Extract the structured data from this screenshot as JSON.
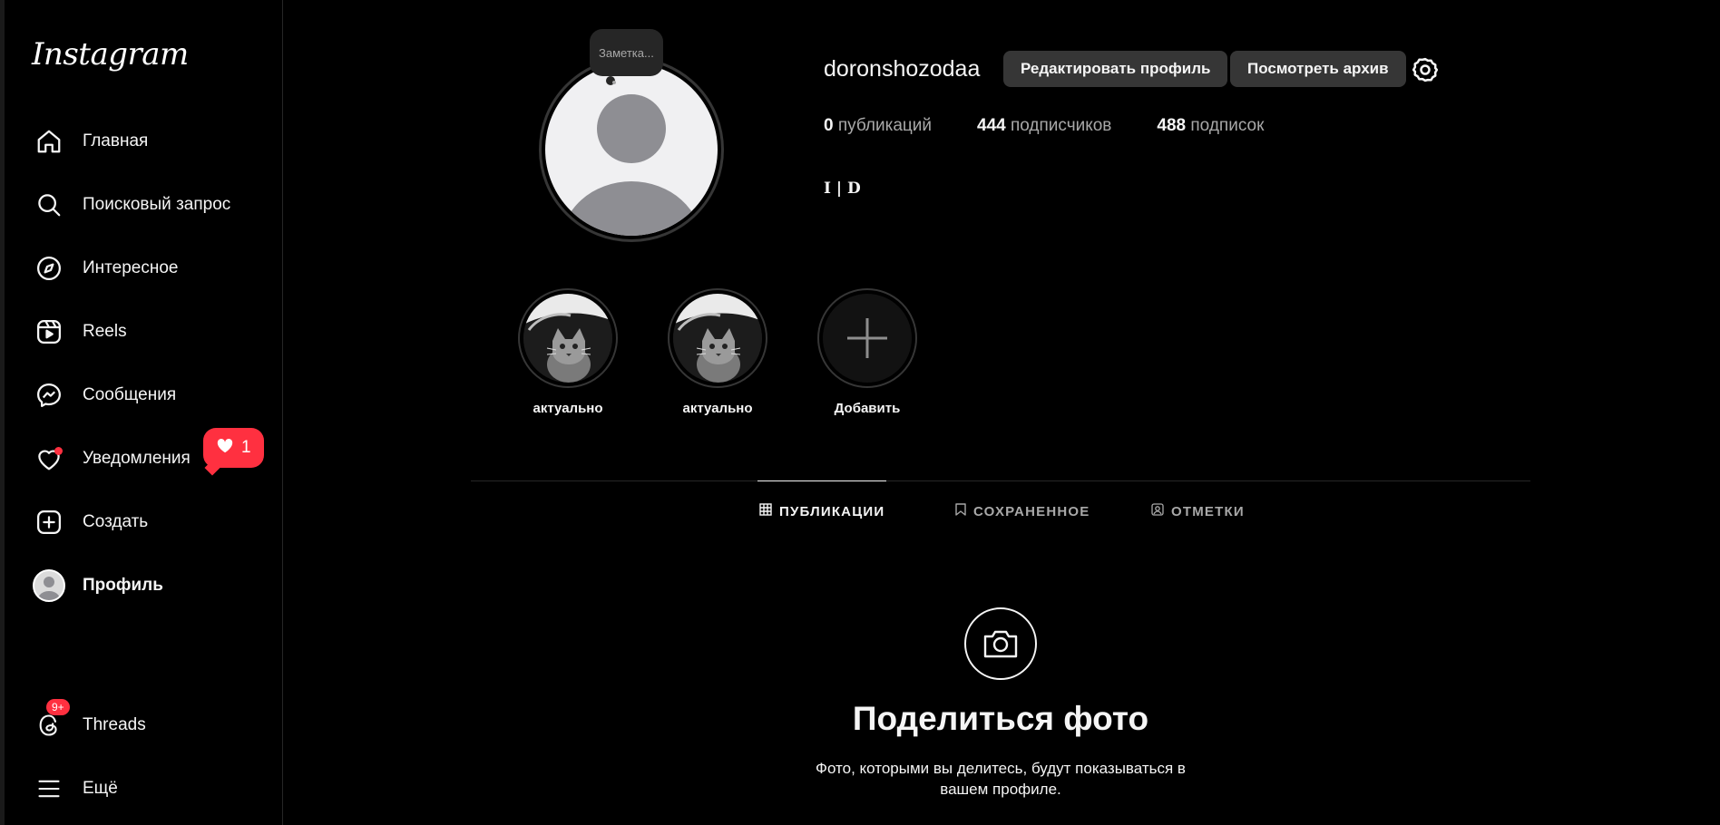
{
  "sidebar": {
    "logo": "Instagram",
    "items": [
      {
        "label": "Главная",
        "icon": "home-icon"
      },
      {
        "label": "Поисковый запрос",
        "icon": "search-icon"
      },
      {
        "label": "Интересное",
        "icon": "compass-icon"
      },
      {
        "label": "Reels",
        "icon": "reels-icon"
      },
      {
        "label": "Сообщения",
        "icon": "messenger-icon"
      },
      {
        "label": "Уведомления",
        "icon": "heart-icon"
      },
      {
        "label": "Создать",
        "icon": "create-icon"
      },
      {
        "label": "Профиль",
        "icon": "avatar"
      },
      {
        "label": "Threads",
        "icon": "threads-icon"
      },
      {
        "label": "Ещё",
        "icon": "menu-icon"
      }
    ],
    "notifications_popup_count": "1",
    "threads_badge": "9+"
  },
  "profile": {
    "note": "Заметка...",
    "username": "doronshozodaa",
    "edit_button": "Редактировать профиль",
    "archive_button": "Посмотреть архив",
    "stats": {
      "posts_count": "0",
      "posts_label": "публикаций",
      "followers_count": "444",
      "followers_label": "подписчиков",
      "following_count": "488",
      "following_label": "подписок"
    },
    "bio": "I | D"
  },
  "highlights": [
    {
      "label": "актуально"
    },
    {
      "label": "актуально"
    },
    {
      "label": "Добавить"
    }
  ],
  "tabs": [
    {
      "label": "ПУБЛИКАЦИИ",
      "icon": "grid-icon",
      "active": true
    },
    {
      "label": "СОХРАНЕННОЕ",
      "icon": "bookmark-icon",
      "active": false
    },
    {
      "label": "ОТМЕТКИ",
      "icon": "tagged-icon",
      "active": false
    }
  ],
  "empty_state": {
    "title": "Поделиться фото",
    "text": "Фото, которыми вы делитесь, будут показываться в вашем профиле."
  },
  "colors": {
    "background": "#000000",
    "notification_red": "#ff3040",
    "button_bg": "#363636",
    "secondary_text": "#a8a8a8"
  }
}
